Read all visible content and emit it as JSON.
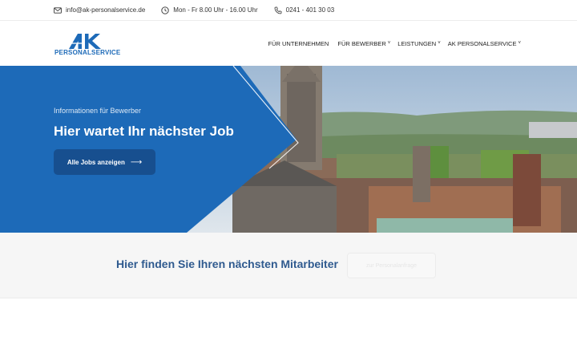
{
  "topbar": {
    "email": "info@ak-personalservice.de",
    "hours": "Mon - Fr 8.00 Uhr - 16.00 Uhr",
    "phone": "0241 - 401 30 03"
  },
  "logo": {
    "mark": "AK",
    "text": "PERSONALSERVICE"
  },
  "nav": [
    {
      "label": "FÜR UNTERNEHMEN",
      "dropdown": ""
    },
    {
      "label": "FÜR BEWERBER",
      "dropdown": "˅"
    },
    {
      "label": "LEISTUNGEN",
      "dropdown": "˅"
    },
    {
      "label": "AK PERSONALSERVICE",
      "dropdown": "˅"
    }
  ],
  "hero": {
    "subtitle": "Informationen für Bewerber",
    "title": "Hier wartet Ihr nächster Job",
    "button": "Alle Jobs anzeigen",
    "button_arrow": "⟶"
  },
  "cta": {
    "title": "Hier finden Sie Ihren nächsten Mitarbeiter",
    "button": "zur Personalanfrage"
  },
  "colors": {
    "brand_blue": "#1d6ab8",
    "dark_blue": "#174f8f",
    "cta_text": "#2f5a8f"
  }
}
